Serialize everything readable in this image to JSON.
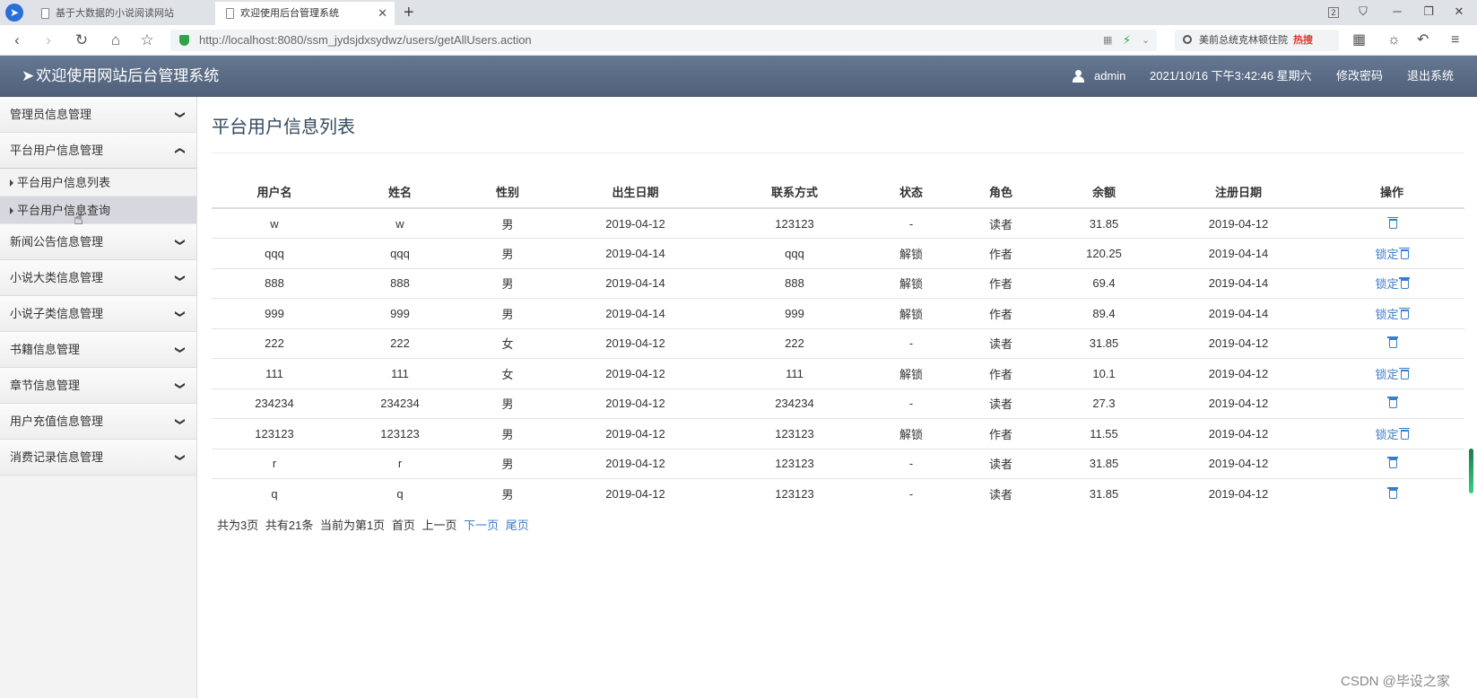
{
  "browser": {
    "tabs": [
      {
        "title": "基于大数据的小说阅读网站"
      },
      {
        "title": "欢迎使用后台管理系统"
      }
    ],
    "new_tab": "+",
    "window_badge": "2",
    "url": "http://localhost:8080/ssm_jydsjdxsydwz/users/getAllUsers.action",
    "search_text": "美前总统克林顿住院",
    "search_hot": "热搜"
  },
  "header": {
    "title": "欢迎使用网站后台管理系统",
    "user": "admin",
    "datetime": "2021/10/16 下午3:42:46 星期六",
    "change_password": "修改密码",
    "logout": "退出系统"
  },
  "sidebar": {
    "groups": [
      {
        "label": "管理员信息管理"
      },
      {
        "label": "平台用户信息管理",
        "children": [
          "平台用户信息列表",
          "平台用户信息查询"
        ]
      },
      {
        "label": "新闻公告信息管理"
      },
      {
        "label": "小说大类信息管理"
      },
      {
        "label": "小说子类信息管理"
      },
      {
        "label": "书籍信息管理"
      },
      {
        "label": "章节信息管理"
      },
      {
        "label": "用户充值信息管理"
      },
      {
        "label": "消费记录信息管理"
      }
    ]
  },
  "main": {
    "title": "平台用户信息列表",
    "columns": [
      "用户名",
      "姓名",
      "性别",
      "出生日期",
      "联系方式",
      "状态",
      "角色",
      "余额",
      "注册日期",
      "操作"
    ],
    "rows": [
      [
        "w",
        "w",
        "男",
        "2019-04-12",
        "123123",
        "-",
        "读者",
        "31.85",
        "2019-04-12",
        ""
      ],
      [
        "qqq",
        "qqq",
        "男",
        "2019-04-14",
        "qqq",
        "解锁",
        "作者",
        "120.25",
        "2019-04-14",
        "锁定"
      ],
      [
        "888",
        "888",
        "男",
        "2019-04-14",
        "888",
        "解锁",
        "作者",
        "69.4",
        "2019-04-14",
        "锁定"
      ],
      [
        "999",
        "999",
        "男",
        "2019-04-14",
        "999",
        "解锁",
        "作者",
        "89.4",
        "2019-04-14",
        "锁定"
      ],
      [
        "222",
        "222",
        "女",
        "2019-04-12",
        "222",
        "-",
        "读者",
        "31.85",
        "2019-04-12",
        ""
      ],
      [
        "111",
        "111",
        "女",
        "2019-04-12",
        "111",
        "解锁",
        "作者",
        "10.1",
        "2019-04-12",
        "锁定"
      ],
      [
        "234234",
        "234234",
        "男",
        "2019-04-12",
        "234234",
        "-",
        "读者",
        "27.3",
        "2019-04-12",
        ""
      ],
      [
        "123123",
        "123123",
        "男",
        "2019-04-12",
        "123123",
        "解锁",
        "作者",
        "11.55",
        "2019-04-12",
        "锁定"
      ],
      [
        "r",
        "r",
        "男",
        "2019-04-12",
        "123123",
        "-",
        "读者",
        "31.85",
        "2019-04-12",
        ""
      ],
      [
        "q",
        "q",
        "男",
        "2019-04-12",
        "123123",
        "-",
        "读者",
        "31.85",
        "2019-04-12",
        ""
      ]
    ],
    "pager": {
      "total_pages": "共为3页",
      "total_records": "共有21条",
      "current": "当前为第1页",
      "first": "首页",
      "prev": "上一页",
      "next": "下一页",
      "last": "尾页"
    }
  },
  "watermark": "CSDN @毕设之家",
  "colors": {
    "header_bg": "#56667f",
    "link": "#3a7dc9",
    "accent_green": "#2fa24b"
  }
}
